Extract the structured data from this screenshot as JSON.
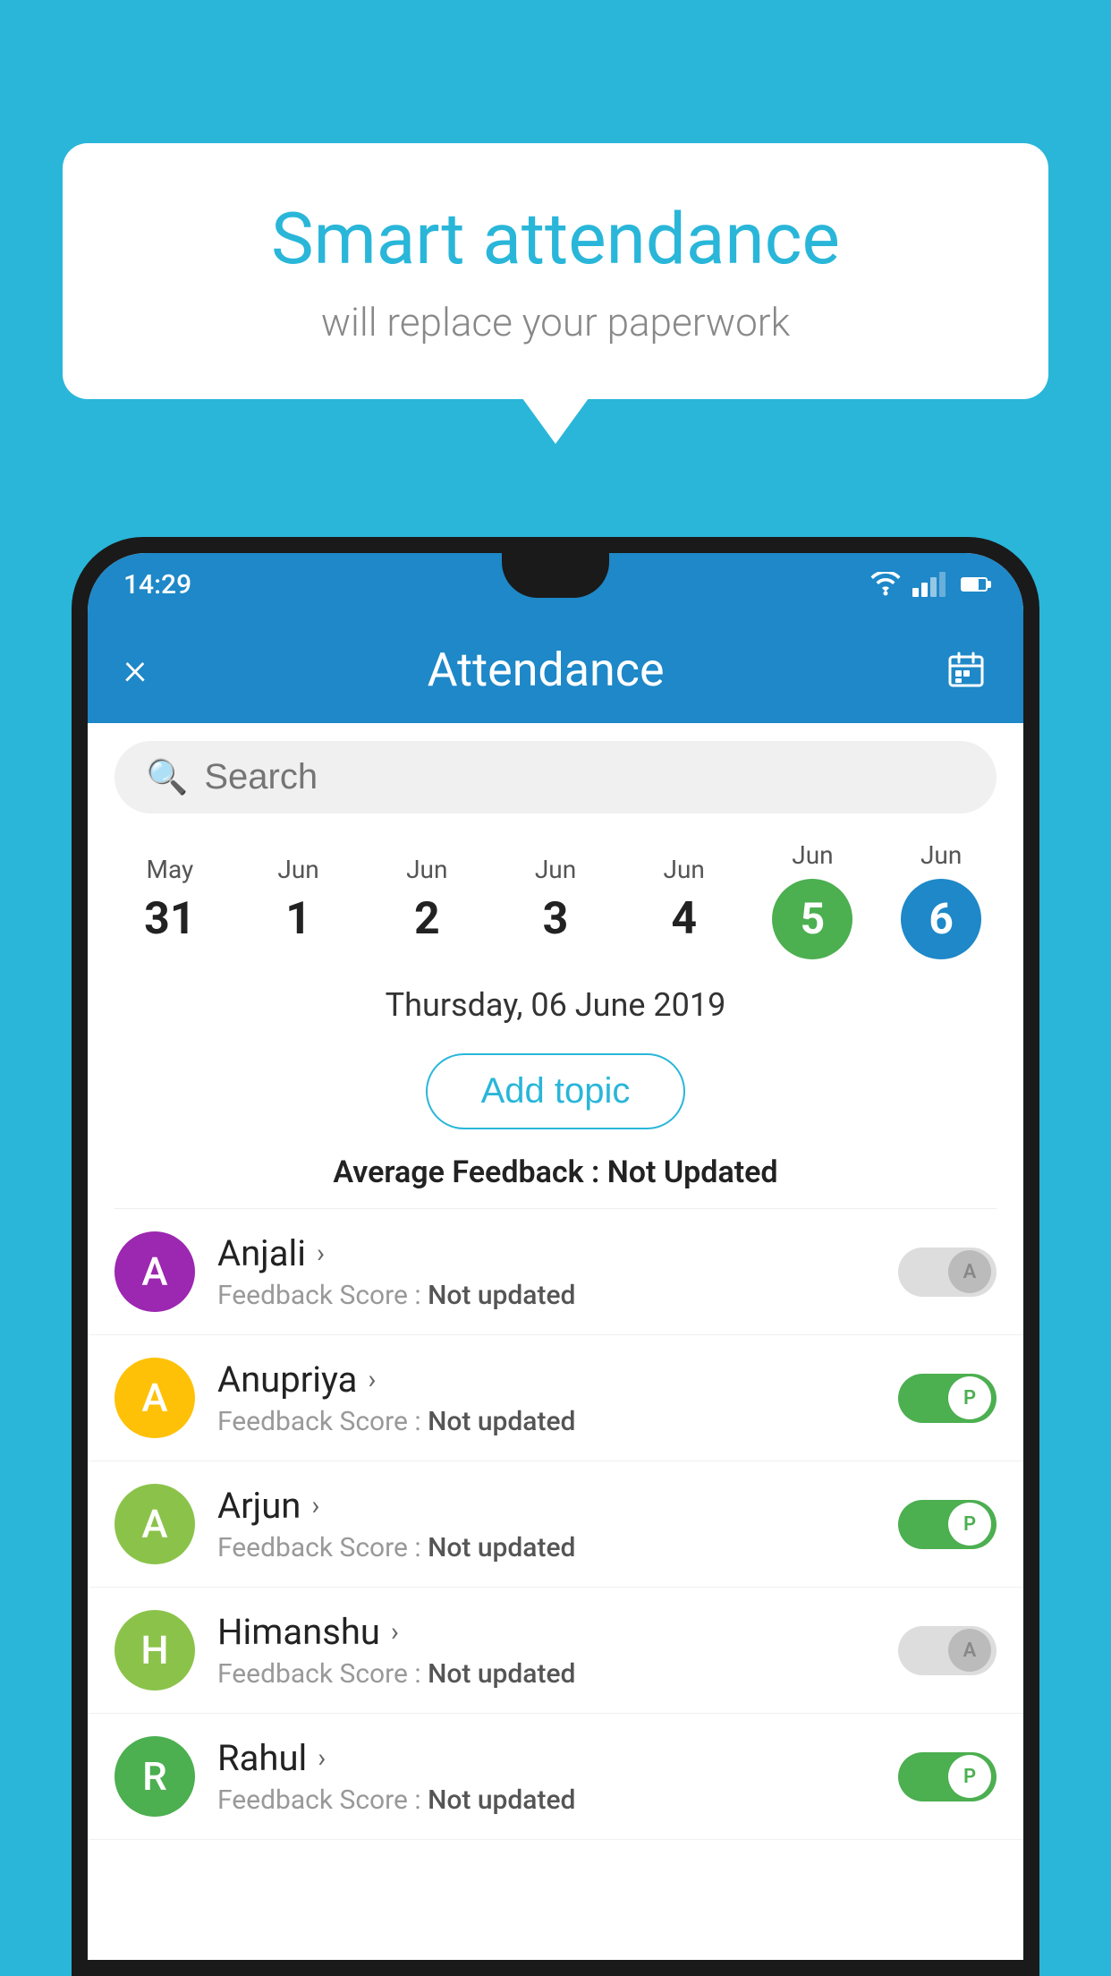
{
  "background_color": "#29B6D9",
  "speech_bubble": {
    "title": "Smart attendance",
    "subtitle": "will replace your paperwork"
  },
  "status_bar": {
    "time": "14:29",
    "wifi_icon": "wifi",
    "signal_icon": "signal",
    "battery_icon": "battery"
  },
  "app_bar": {
    "title": "Attendance",
    "close_label": "×",
    "calendar_icon": "calendar"
  },
  "search": {
    "placeholder": "Search",
    "icon": "search-icon"
  },
  "calendar": {
    "days": [
      {
        "month": "May",
        "date": "31",
        "selected": ""
      },
      {
        "month": "Jun",
        "date": "1",
        "selected": ""
      },
      {
        "month": "Jun",
        "date": "2",
        "selected": ""
      },
      {
        "month": "Jun",
        "date": "3",
        "selected": ""
      },
      {
        "month": "Jun",
        "date": "4",
        "selected": ""
      },
      {
        "month": "Jun",
        "date": "5",
        "selected": "green"
      },
      {
        "month": "Jun",
        "date": "6",
        "selected": "blue"
      }
    ]
  },
  "selected_date": "Thursday, 06 June 2019",
  "add_topic_label": "Add topic",
  "avg_feedback_label": "Average Feedback :",
  "avg_feedback_value": "Not Updated",
  "students": [
    {
      "name": "Anjali",
      "avatar_letter": "A",
      "avatar_color": "#9C27B0",
      "feedback_label": "Feedback Score :",
      "feedback_value": "Not updated",
      "toggle": "off",
      "toggle_letter": "A"
    },
    {
      "name": "Anupriya",
      "avatar_letter": "A",
      "avatar_color": "#FFC107",
      "feedback_label": "Feedback Score :",
      "feedback_value": "Not updated",
      "toggle": "on",
      "toggle_letter": "P"
    },
    {
      "name": "Arjun",
      "avatar_letter": "A",
      "avatar_color": "#8BC34A",
      "feedback_label": "Feedback Score :",
      "feedback_value": "Not updated",
      "toggle": "on",
      "toggle_letter": "P"
    },
    {
      "name": "Himanshu",
      "avatar_letter": "H",
      "avatar_color": "#8BC34A",
      "feedback_label": "Feedback Score :",
      "feedback_value": "Not updated",
      "toggle": "off",
      "toggle_letter": "A"
    },
    {
      "name": "Rahul",
      "avatar_letter": "R",
      "avatar_color": "#4CAF50",
      "feedback_label": "Feedback Score :",
      "feedback_value": "Not updated",
      "toggle": "on",
      "toggle_letter": "P"
    }
  ]
}
